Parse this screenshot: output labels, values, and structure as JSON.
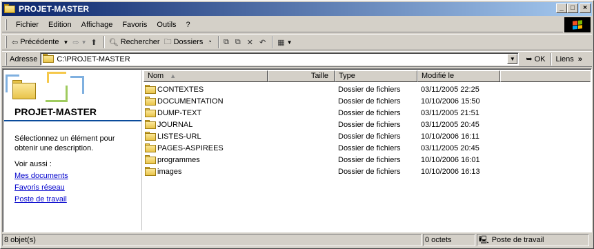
{
  "window": {
    "title": "PROJET-MASTER",
    "buttons": [
      "_",
      "□",
      "×"
    ]
  },
  "menu": [
    "Fichier",
    "Edition",
    "Affichage",
    "Favoris",
    "Outils",
    "?"
  ],
  "toolbar": {
    "back": "Précédente",
    "search": "Rechercher",
    "folders": "Dossiers"
  },
  "address": {
    "label": "Adresse",
    "value": "C:\\PROJET-MASTER",
    "go": "OK",
    "links": "Liens",
    "chevron": "»"
  },
  "left_panel": {
    "title": "PROJET-MASTER",
    "description": "Sélectionnez un élément pour obtenir une description.",
    "see_also": "Voir aussi :",
    "links": [
      "Mes documents",
      "Favoris réseau",
      "Poste de travail"
    ]
  },
  "columns": {
    "name": "Nom",
    "size": "Taille",
    "type": "Type",
    "modified": "Modifié le"
  },
  "files": [
    {
      "name": "CONTEXTES",
      "size": "",
      "type": "Dossier de fichiers",
      "modified": "03/11/2005 22:25"
    },
    {
      "name": "DOCUMENTATION",
      "size": "",
      "type": "Dossier de fichiers",
      "modified": "10/10/2006 15:50"
    },
    {
      "name": "DUMP-TEXT",
      "size": "",
      "type": "Dossier de fichiers",
      "modified": "03/11/2005 21:51"
    },
    {
      "name": "JOURNAL",
      "size": "",
      "type": "Dossier de fichiers",
      "modified": "03/11/2005 20:45"
    },
    {
      "name": "LISTES-URL",
      "size": "",
      "type": "Dossier de fichiers",
      "modified": "10/10/2006 16:11"
    },
    {
      "name": "PAGES-ASPIREES",
      "size": "",
      "type": "Dossier de fichiers",
      "modified": "03/11/2005 20:45"
    },
    {
      "name": "programmes",
      "size": "",
      "type": "Dossier de fichiers",
      "modified": "10/10/2006 16:01"
    },
    {
      "name": "images",
      "size": "",
      "type": "Dossier de fichiers",
      "modified": "10/10/2006 16:13"
    }
  ],
  "status": {
    "count": "8 objet(s)",
    "size": "0 octets",
    "location": "Poste de travail"
  },
  "colors": {
    "titlebar_start": "#0a246a",
    "titlebar_end": "#a6caf0",
    "link": "#0000cc",
    "folder": "#e8c44a"
  }
}
